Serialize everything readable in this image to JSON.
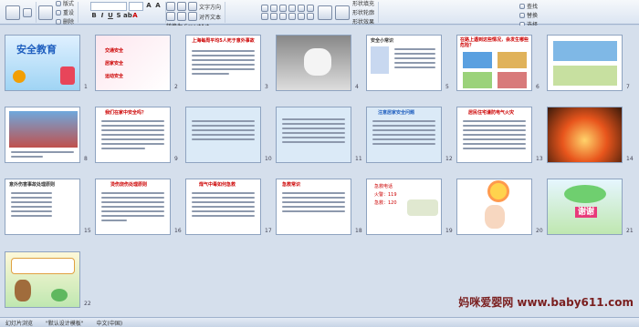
{
  "ribbon": {
    "new_slide": "新建幻灯片",
    "layout": "版式",
    "reset": "重设",
    "delete": "删除",
    "font_name": "",
    "font_size": "",
    "text_direction": "文字方向",
    "align_text": "对齐文本",
    "smartart": "转换为 SmartArt",
    "shape_fill": "形状填充",
    "shape_outline": "形状轮廓",
    "shape_effects": "形状效果",
    "quick_styles": "快速样式",
    "find": "查找",
    "replace": "替换",
    "select": "选择"
  },
  "slides": [
    {
      "n": "1",
      "text": "安全教育"
    },
    {
      "n": "2",
      "text": "交通安全\n居家安全\n运动安全"
    },
    {
      "n": "3",
      "text": "上海每周平均5人死于意外事故"
    },
    {
      "n": "4",
      "text": ""
    },
    {
      "n": "5",
      "text": "安全小常识"
    },
    {
      "n": "6",
      "text": "在路上遇到这些情况，会发生哪些危险？"
    },
    {
      "n": "7",
      "text": ""
    },
    {
      "n": "8",
      "text": ""
    },
    {
      "n": "9",
      "text": "我们在家中安全吗？"
    },
    {
      "n": "10",
      "text": ""
    },
    {
      "n": "11",
      "text": ""
    },
    {
      "n": "12",
      "text": "注意居家安全问题"
    },
    {
      "n": "13",
      "text": "居民住宅谨防电气火灾"
    },
    {
      "n": "14",
      "text": ""
    },
    {
      "n": "15",
      "text": "意外伤害事故处理原则"
    },
    {
      "n": "16",
      "text": "烫伤烧伤处理原则"
    },
    {
      "n": "17",
      "text": "煤气中毒如何急救"
    },
    {
      "n": "18",
      "text": "急救常识"
    },
    {
      "n": "19",
      "text": "急救电话\n火警：119\n急救：120"
    },
    {
      "n": "20",
      "text": ""
    },
    {
      "n": "21",
      "text": "谢谢"
    },
    {
      "n": "22",
      "text": ""
    }
  ],
  "status": {
    "slide_info": "幻灯片浏览",
    "theme": "\"默认设计模板\"",
    "lang": "中文(中国)"
  },
  "watermark": "妈咪爱婴网 www.baby611.com",
  "colors": {
    "accent": "#c00000",
    "sorter_bg": "#d5dfec"
  }
}
